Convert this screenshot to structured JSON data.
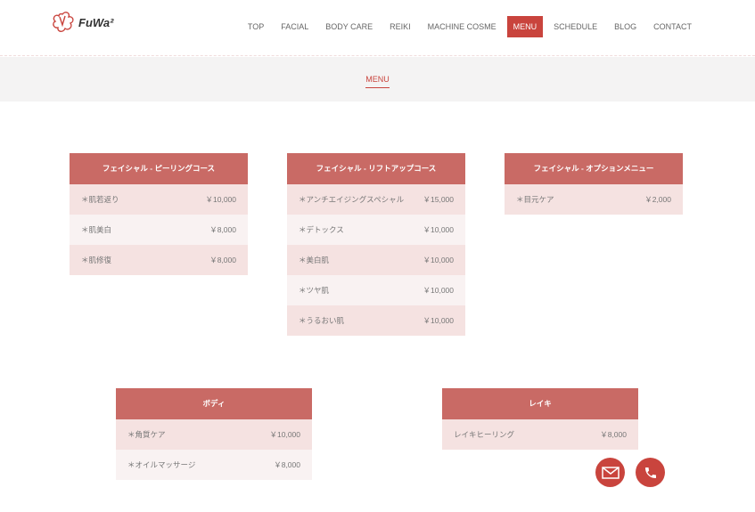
{
  "logo": {
    "text": "FuWa²"
  },
  "nav": [
    "TOP",
    "FACIAL",
    "BODY CARE",
    "REIKI",
    "MACHINE COSME",
    "MENU",
    "SCHEDULE",
    "BLOG",
    "CONTACT"
  ],
  "nav_active": "MENU",
  "page_title": "MENU",
  "colors": {
    "accent": "#c9443d",
    "card_header": "#c96a65",
    "row_a": "#f5e2e1",
    "row_b": "#f9f2f2"
  },
  "cards": [
    {
      "title": "フェイシャル - ピーリングコース",
      "items": [
        {
          "name": "＊肌若返り",
          "price": "￥10,000"
        },
        {
          "name": "＊肌美白",
          "price": "￥8,000"
        },
        {
          "name": "＊肌修復",
          "price": "￥8,000"
        }
      ]
    },
    {
      "title": "フェイシャル - リフトアップコース",
      "items": [
        {
          "name": "＊アンチエイジングスペシャル",
          "price": "￥15,000"
        },
        {
          "name": "＊デトックス",
          "price": "￥10,000"
        },
        {
          "name": "＊美白肌",
          "price": "￥10,000"
        },
        {
          "name": "＊ツヤ肌",
          "price": "￥10,000"
        },
        {
          "name": "＊うるおい肌",
          "price": "￥10,000"
        }
      ]
    },
    {
      "title": "フェイシャル - オプションメニュー",
      "items": [
        {
          "name": "＊目元ケア",
          "price": "￥2,000"
        }
      ]
    },
    {
      "title": "ボディ",
      "items": [
        {
          "name": "＊角質ケア",
          "price": "￥10,000"
        },
        {
          "name": "＊オイルマッサージ",
          "price": "￥8,000"
        }
      ]
    },
    {
      "title": "レイキ",
      "items": [
        {
          "name": "レイキヒーリング",
          "price": "￥8,000"
        }
      ]
    }
  ],
  "fabs": [
    {
      "icon": "mail-icon"
    },
    {
      "icon": "phone-icon"
    }
  ]
}
